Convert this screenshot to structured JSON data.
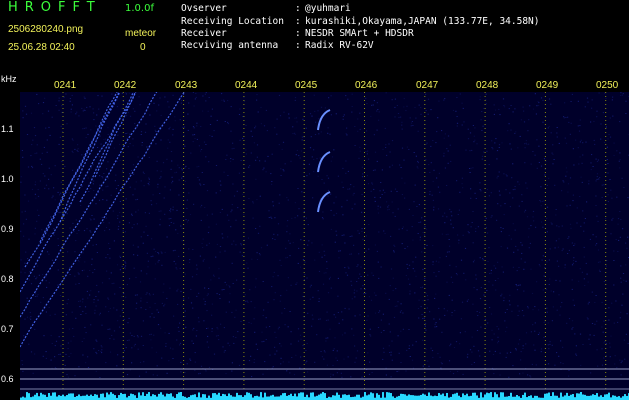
{
  "header": {
    "app_title": "HROFFT",
    "version": "1.0.0f",
    "filename": "2506280240.png",
    "timestamp": "25.06.28 02:40",
    "meteor_label": "meteor",
    "meteor_count": "0",
    "info": [
      {
        "label": "Ovserver",
        "value": "@yuhmari"
      },
      {
        "label": "Receiving Location",
        "value": "kurashiki,Okayama,JAPAN (133.77E, 34.58N)"
      },
      {
        "label": "Receiver",
        "value": "NESDR SMArt + HDSDR"
      },
      {
        "label": "Recviving antenna",
        "value": "Radix RV-62V"
      }
    ],
    "separator": ":"
  },
  "spectrogram": {
    "y_unit": "kHz",
    "y_ticks": [
      "1.1",
      "1.0",
      "0.9",
      "0.8",
      "0.7",
      "0.6"
    ],
    "x_ticks": [
      "0241",
      "0242",
      "0243",
      "0244",
      "0245",
      "0246",
      "0247",
      "0248",
      "0249",
      "0250"
    ],
    "colors": {
      "background": "#00002a",
      "signal": "#4a70ff",
      "noise_floor": "#28d8ff",
      "grid": "#c8c800"
    }
  }
}
